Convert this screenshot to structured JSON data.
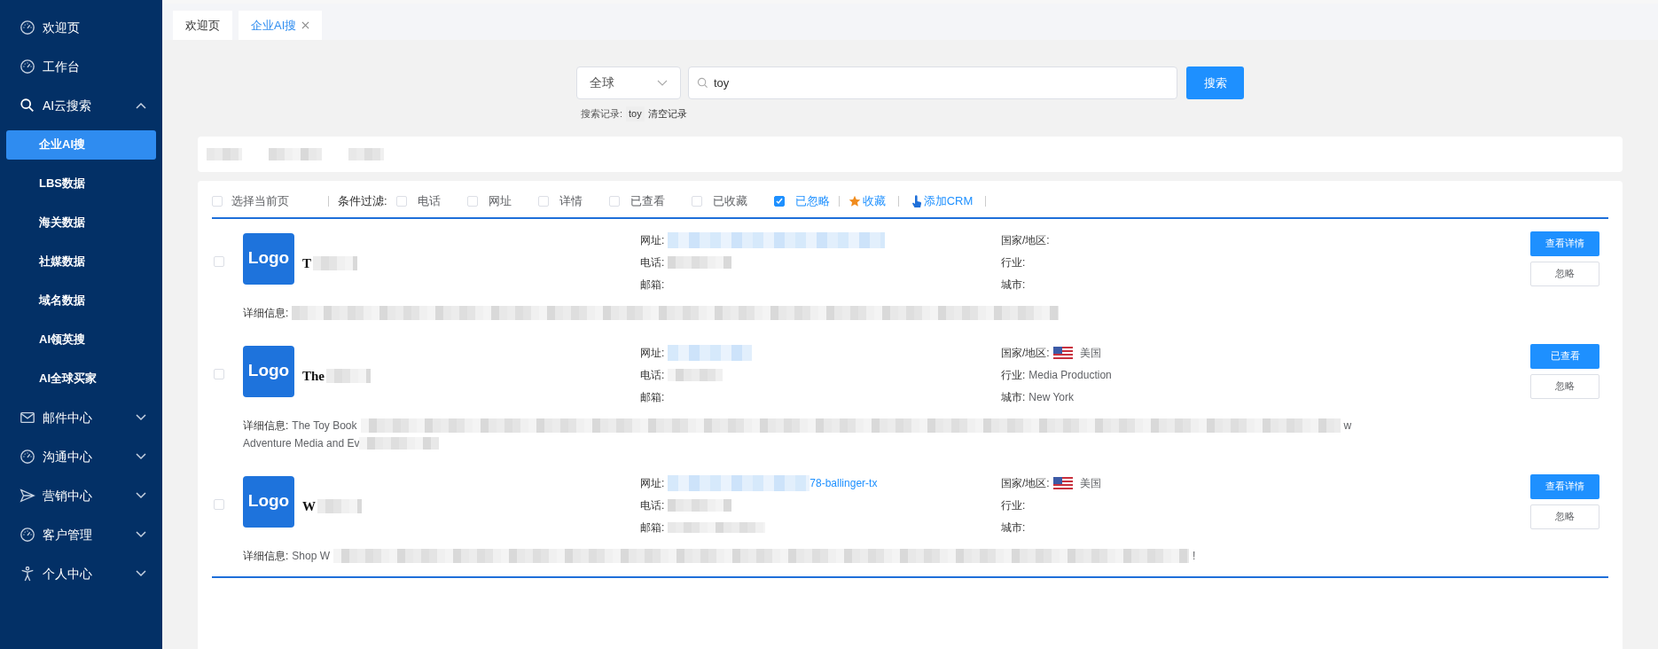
{
  "sidebar": {
    "items": [
      {
        "label": "欢迎页",
        "selected": false
      },
      {
        "label": "工作台",
        "selected": false
      },
      {
        "label": "AI云搜索",
        "selected": false,
        "expanded": true,
        "children": [
          {
            "label": "企业AI搜",
            "selected": true
          },
          {
            "label": "LBS数据",
            "selected": false
          },
          {
            "label": "海关数据",
            "selected": false
          },
          {
            "label": "社媒数据",
            "selected": false
          },
          {
            "label": "域名数据",
            "selected": false
          },
          {
            "label": "AI领英搜",
            "selected": false
          },
          {
            "label": "AI全球买家",
            "selected": false
          }
        ]
      },
      {
        "label": "邮件中心",
        "selected": false,
        "expanded": false
      },
      {
        "label": "沟通中心",
        "selected": false,
        "expanded": false
      },
      {
        "label": "营销中心",
        "selected": false,
        "expanded": false
      },
      {
        "label": "客户管理",
        "selected": false,
        "expanded": false
      },
      {
        "label": "个人中心",
        "selected": false,
        "expanded": false
      }
    ]
  },
  "tabs": [
    {
      "label": "欢迎页",
      "selected": false,
      "closable": false
    },
    {
      "label": "企业AI搜",
      "selected": true,
      "closable": true
    }
  ],
  "search": {
    "scope": "全球",
    "value": "toy",
    "button": "搜索",
    "history_label": "搜索记录:",
    "history": [
      "toy"
    ],
    "clear": "清空记录"
  },
  "filter_bar": {
    "select_page": {
      "label": "选择当前页",
      "checked": false
    },
    "filter_label": "条件过滤:",
    "filters": [
      {
        "label": "电话",
        "checked": false
      },
      {
        "label": "网址",
        "checked": false
      },
      {
        "label": "详情",
        "checked": false
      },
      {
        "label": "已查看",
        "checked": false
      },
      {
        "label": "已收藏",
        "checked": false
      },
      {
        "label": "已忽略",
        "checked": true
      }
    ],
    "favorite": "收藏",
    "add_crm": "添加CRM"
  },
  "results": [
    {
      "checked": false,
      "logo": "Logo",
      "name": {
        "text": "T",
        "blurred": true
      },
      "website_label": "网址:",
      "website": {
        "blurred": true
      },
      "phone_label": "电话:",
      "phone": {
        "blurred": true
      },
      "email_label": "邮箱:",
      "country_label": "国家/地区:",
      "industry_label": "行业:",
      "city_label": "城市:",
      "details_label": "详细信息:",
      "details": {
        "blurred": true
      },
      "primary_button": "查看详情",
      "ignore_button": "忽略"
    },
    {
      "checked": false,
      "logo": "Logo",
      "name": {
        "text": "The",
        "blurred": true
      },
      "website_label": "网址:",
      "website": {
        "blurred": true
      },
      "phone_label": "电话:",
      "phone": {
        "blurred": true
      },
      "email_label": "邮箱:",
      "country_label": "国家/地区:",
      "country": "美国",
      "industry_label": "行业:",
      "industry": "Media Production",
      "city_label": "城市:",
      "city": "New York",
      "details_label": "详细信息:",
      "details": {
        "text": "The Toy Book",
        "blurred": true,
        "tail": "w",
        "line2": "Adventure Media and Ev"
      },
      "primary_button": "已查看",
      "ignore_button": "忽略"
    },
    {
      "checked": false,
      "logo": "Logo",
      "name": {
        "text": "W",
        "blurred": true
      },
      "website_label": "网址:",
      "website": {
        "blurred": true,
        "tail": "78-ballinger-tx"
      },
      "phone_label": "电话:",
      "phone": {
        "blurred": true
      },
      "email_label": "邮箱:",
      "email": {
        "blurred": true
      },
      "country_label": "国家/地区:",
      "country": "美国",
      "industry_label": "行业:",
      "city_label": "城市:",
      "details_label": "详细信息:",
      "details": {
        "text": "Shop W",
        "blurred": true,
        "tail": "!"
      },
      "primary_button": "查看详情",
      "ignore_button": "忽略"
    }
  ]
}
